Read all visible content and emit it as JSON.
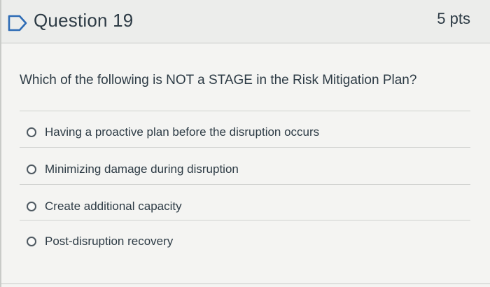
{
  "question": {
    "title": "Question 19",
    "points": "5 pts",
    "prompt": "Which of the following is NOT a STAGE in the Risk Mitigation Plan?",
    "answers": [
      {
        "label": "Having a proactive plan before the disruption occurs",
        "selected": false
      },
      {
        "label": "Minimizing damage during disruption",
        "selected": false
      },
      {
        "label": "Create additional capacity",
        "selected": false
      },
      {
        "label": "Post-disruption recovery",
        "selected": false
      }
    ]
  },
  "icons": {
    "flag": "flag-outline-icon"
  },
  "colors": {
    "text": "#2d3b45",
    "header_bg": "#ecedeb",
    "body_bg": "#f4f4f2",
    "flag_stroke": "#2d6bb5"
  }
}
